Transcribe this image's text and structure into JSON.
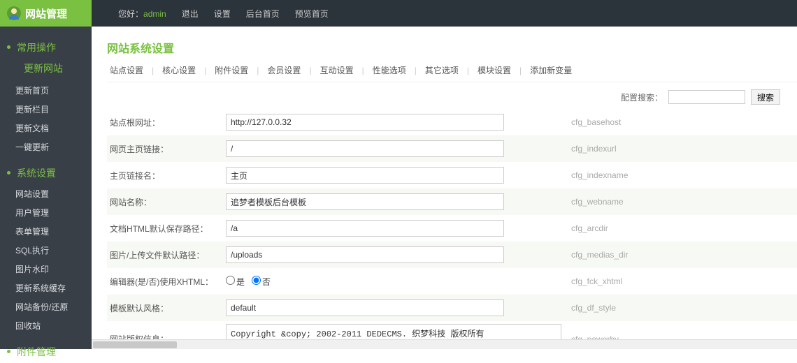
{
  "top": {
    "brand": "网站管理",
    "hello": "您好：",
    "admin": "admin",
    "links": [
      "退出",
      "设置",
      "后台首页",
      "预览首页"
    ]
  },
  "sidebar": {
    "g1": "常用操作",
    "g1_sub": "更新网站",
    "g1_items": [
      "更新首页",
      "更新栏目",
      "更新文档",
      "一键更新"
    ],
    "g2": "系统设置",
    "g2_items": [
      "网站设置",
      "用户管理",
      "表单管理",
      "SQL执行",
      "图片水印",
      "更新系统缓存",
      "网站备份/还原",
      "回收站"
    ],
    "g3": "附件管理"
  },
  "page": {
    "title": "网站系统设置",
    "tabs": [
      "站点设置",
      "核心设置",
      "附件设置",
      "会员设置",
      "互动设置",
      "性能选项",
      "其它选项",
      "模块设置",
      "添加新变量"
    ],
    "search_label": "配置搜索：",
    "search_btn": "搜索"
  },
  "rows": [
    {
      "label": "站点根网址：",
      "value": "http://127.0.0.32",
      "cfg": "cfg_basehost",
      "type": "text"
    },
    {
      "label": "网页主页链接：",
      "value": "/",
      "cfg": "cfg_indexurl",
      "type": "text"
    },
    {
      "label": "主页链接名：",
      "value": "主页",
      "cfg": "cfg_indexname",
      "type": "text"
    },
    {
      "label": "网站名称：",
      "value": "追梦者模板后台模板",
      "cfg": "cfg_webname",
      "type": "text"
    },
    {
      "label": "文档HTML默认保存路径：",
      "value": "/a",
      "cfg": "cfg_arcdir",
      "type": "text"
    },
    {
      "label": "图片/上传文件默认路径：",
      "value": "/uploads",
      "cfg": "cfg_medias_dir",
      "type": "text"
    },
    {
      "label": "编辑器(是/否)使用XHTML：",
      "value": "",
      "cfg": "cfg_fck_xhtml",
      "type": "radio",
      "opt_yes": "是",
      "opt_no": "否"
    },
    {
      "label": "模板默认风格：",
      "value": "default",
      "cfg": "cfg_df_style",
      "type": "text"
    },
    {
      "label": "网站版权信息：",
      "value": "Copyright &copy; 2002-2011 DEDECMS. 织梦科技 版权所有",
      "cfg": "cfg_powerby",
      "type": "textarea"
    }
  ]
}
